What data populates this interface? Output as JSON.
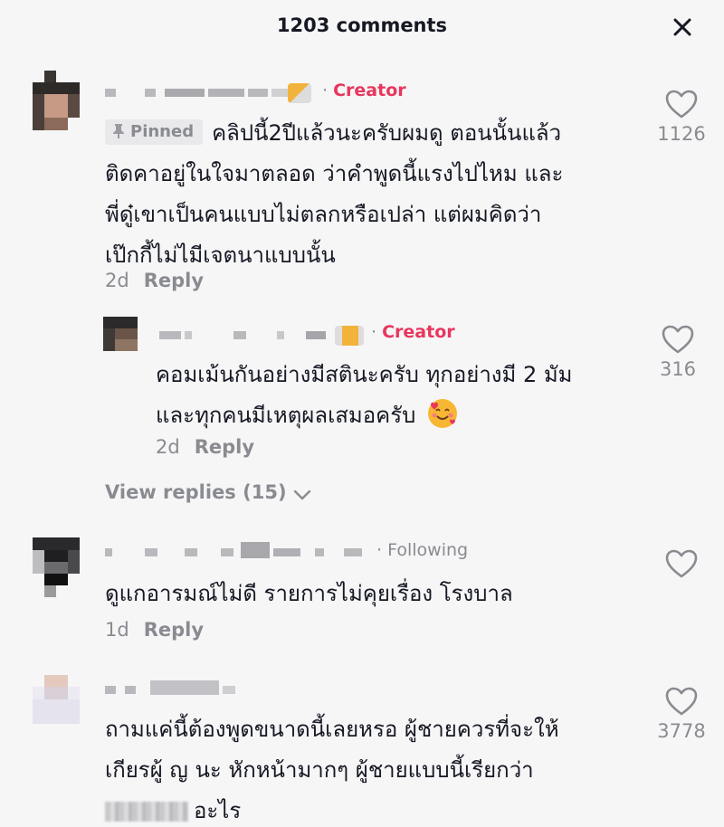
{
  "header": {
    "title": "1203 comments"
  },
  "comments": [
    {
      "tag": "Creator",
      "pinned_label": "Pinned",
      "text_lines": [
        "คลิปนี้2ปีแล้วนะครับผมดู ตอนนั้นแล้ว",
        "ติดคาอยู่ในใจมาตลอด ว่าคำพูดนี้แรงไปไหม และ",
        "พี่ดู๋เขาเป็นคนแบบไม่ตลกหรือเปล่า แต่ผมคิดว่า",
        "เป๊กกี้ไม่ไมีเจตนาแบบนั้น"
      ],
      "age": "2d",
      "reply_label": "Reply",
      "likes": "1126"
    },
    {
      "tag": "Creator",
      "text_lines": [
        "คอมเม้นกันอย่างมีสตินะครับ ทุกอย่างมี 2 มัม",
        "และทุกคนมีเหตุผลเสมอครับ"
      ],
      "age": "2d",
      "reply_label": "Reply",
      "likes": "316"
    },
    {
      "tag": "Following",
      "text_lines": [
        "ดูแกอารมณ์ไม่ดี รายการไม่คุยเรื่อง โรงบาล"
      ],
      "age": "1d",
      "reply_label": "Reply",
      "likes": ""
    },
    {
      "tag": "",
      "text_lines": [
        "ถามแค่นี้ต้องพูดขนาดนี้เลยหรอ ผู้ชายควรที่จะให้",
        "เกียรผู้ ญ นะ หักหน้ามากๆ ผู้ชายแบบนี้เรียกว่า",
        "อะไร"
      ],
      "likes": "3778"
    }
  ],
  "view_replies": "View replies (15)",
  "icons": {
    "close": "close-icon",
    "heart": "heart-outline-icon",
    "chevron": "chevron-down-icon",
    "pin": "pin-icon",
    "emoji": "smiling-face-with-hearts-emoji"
  },
  "colors": {
    "background": "#f6f6f7",
    "creator": "#e8365d",
    "muted": "#8a8b91",
    "text": "#161823"
  }
}
